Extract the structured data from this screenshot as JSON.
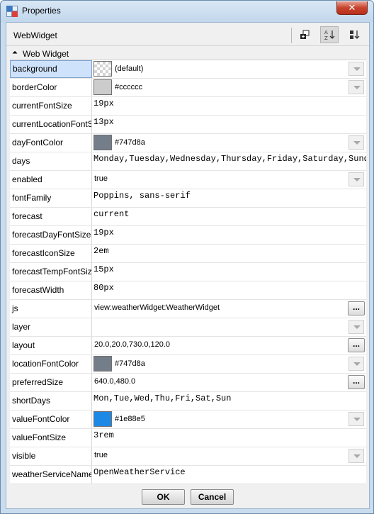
{
  "window": {
    "title": "Properties",
    "close_label": "✕"
  },
  "header": {
    "title": "WebWidget"
  },
  "section": {
    "label": "Web Widget",
    "chevron": "⏶"
  },
  "colors": {
    "selected_row_bg": "#cfe2fb",
    "border_color_swatch": "#cccccc",
    "day_font_swatch": "#747d8a",
    "location_font_swatch": "#747d8a",
    "value_font_swatch": "#1e88e5"
  },
  "properties": [
    {
      "name": "background",
      "value": "(default)",
      "editor": "color",
      "swatch": "checker",
      "control": "dropdown",
      "selected": true
    },
    {
      "name": "borderColor",
      "value": "#cccccc",
      "editor": "color",
      "swatch": "#cccccc",
      "control": "dropdown"
    },
    {
      "name": "currentFontSize",
      "value": "19px",
      "editor": "mono"
    },
    {
      "name": "currentLocationFontS",
      "value": "13px",
      "editor": "mono"
    },
    {
      "name": "dayFontColor",
      "value": "#747d8a",
      "editor": "color",
      "swatch": "#747d8a",
      "control": "dropdown"
    },
    {
      "name": "days",
      "value": "Monday,Tuesday,Wednesday,Thursday,Friday,Saturday,Sunda",
      "editor": "mono"
    },
    {
      "name": "enabled",
      "value": "true",
      "editor": "text",
      "control": "dropdown"
    },
    {
      "name": "fontFamily",
      "value": "Poppins, sans-serif",
      "editor": "mono"
    },
    {
      "name": "forecast",
      "value": "current",
      "editor": "mono"
    },
    {
      "name": "forecastDayFontSize",
      "value": "19px",
      "editor": "mono"
    },
    {
      "name": "forecastIconSize",
      "value": "2em",
      "editor": "mono"
    },
    {
      "name": "forecastTempFontSize",
      "value": "15px",
      "editor": "mono"
    },
    {
      "name": "forecastWidth",
      "value": "80px",
      "editor": "mono"
    },
    {
      "name": "js",
      "value": "view:weatherWidget:WeatherWidget",
      "editor": "text",
      "control": "ellipsis"
    },
    {
      "name": "layer",
      "value": "",
      "editor": "text",
      "control": "dropdown"
    },
    {
      "name": "layout",
      "value": "20.0,20.0,730.0,120.0",
      "editor": "text",
      "control": "ellipsis"
    },
    {
      "name": "locationFontColor",
      "value": "#747d8a",
      "editor": "color",
      "swatch": "#747d8a",
      "control": "dropdown"
    },
    {
      "name": "preferredSize",
      "value": "640.0,480.0",
      "editor": "text",
      "control": "ellipsis"
    },
    {
      "name": "shortDays",
      "value": "Mon,Tue,Wed,Thu,Fri,Sat,Sun",
      "editor": "mono"
    },
    {
      "name": "valueFontColor",
      "value": "#1e88e5",
      "editor": "color",
      "swatch": "#1e88e5",
      "control": "dropdown"
    },
    {
      "name": "valueFontSize",
      "value": "3rem",
      "editor": "mono"
    },
    {
      "name": "visible",
      "value": "true",
      "editor": "text",
      "control": "dropdown"
    },
    {
      "name": "weatherServiceName",
      "value": "OpenWeatherService",
      "editor": "mono"
    }
  ],
  "controls": {
    "ellipsis_label": "..."
  },
  "buttons": {
    "ok": "OK",
    "cancel": "Cancel"
  }
}
